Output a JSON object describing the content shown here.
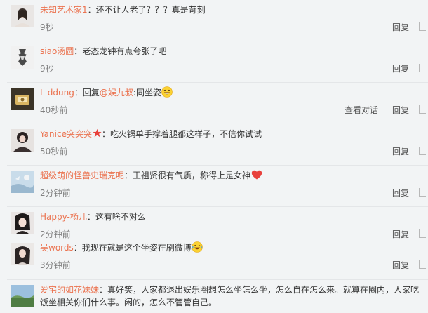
{
  "comments": [
    {
      "user": "未知艺术家1",
      "colon": "：",
      "text": "还不让人老了？？？真是苛刻",
      "time": "9秒",
      "reply": "回复"
    },
    {
      "user": "siao汤圆",
      "colon": "：",
      "text": "老态龙钟有点夸张了吧",
      "time": "9秒",
      "reply": "回复"
    },
    {
      "user": "L-ddung",
      "colon": "：",
      "text_before": "回复",
      "mention": "@娱九叔",
      "text": ":同坐姿",
      "time": "40秒前",
      "view": "查看对话",
      "reply": "回复",
      "emoji": "laugh-emoji"
    },
    {
      "user": "Yanice突突突",
      "colon": "：",
      "text": "吃火锅单手撑着腿都这样子，不信你试试",
      "time": "50秒前",
      "reply": "回复",
      "badge": "star-badge-icon"
    },
    {
      "user": "超级萌的怪兽史瑞克呢",
      "colon": "：",
      "text": "王祖贤很有气质，称得上是女神",
      "time": "2分钟前",
      "reply": "回复",
      "emoji": "heart-emoji"
    },
    {
      "user": "Happy-杨儿",
      "colon": "：",
      "text": "这有啥不对么",
      "time": "2分钟前",
      "reply": "回复"
    },
    {
      "user": "吴words",
      "colon": "：",
      "text": "我现在就是这个坐姿在刷微博",
      "time": "3分钟前",
      "reply": "回复",
      "emoji": "laugh-cry-emoji"
    },
    {
      "user": "爱宅的如花妹妹",
      "colon": "：",
      "text": "真好笑，人家都退出娱乐圈想怎么坐怎么坐，怎么自在怎么来。就算在圈内，人家吃饭坐相关你们什么事。闲的，怎么不管管自己。"
    }
  ],
  "colors": {
    "username": "#eb7350",
    "heart": "#e8413c",
    "star": "#e8413c"
  }
}
